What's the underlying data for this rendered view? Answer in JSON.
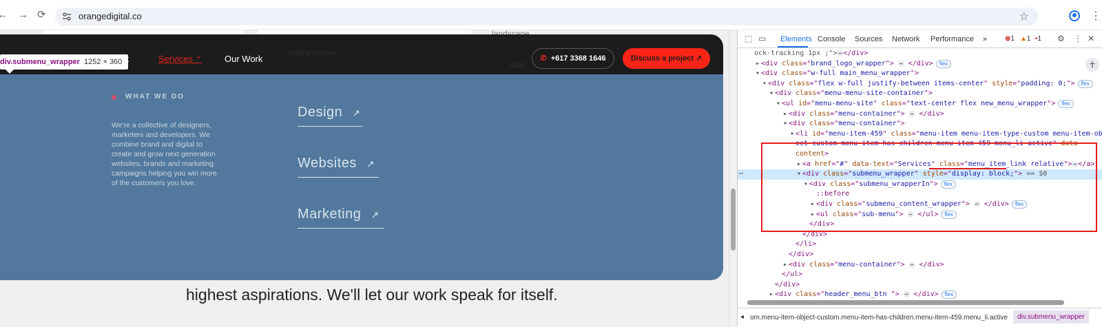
{
  "browser": {
    "back_icon": "arrow-left-icon",
    "forward_icon": "arrow-right-icon",
    "reload_icon": "reload-icon",
    "url": "orangedigital.co"
  },
  "page": {
    "landscape_text": "landscape.",
    "nav": {
      "about": "bout",
      "services": "Services",
      "our_work": "Our Work"
    },
    "phone": "+617 3368 1646",
    "cta": "Discuss a project",
    "faded_text_1": "Start a journey",
    "faded_text_2": "Start",
    "submenu": {
      "heading": "WHAT WE DO",
      "about": "We're a collective of designers, marketers and developers. We combine brand and digital to create and grow next generation websites, brands and marketing campaigns helping you win more of the customers you love.",
      "items": [
        {
          "label": "Design"
        },
        {
          "label": "Websites"
        },
        {
          "label": "Marketing"
        }
      ]
    },
    "bottom_text": "highest aspirations. We'll let our work speak for itself.",
    "tooltip": {
      "selector": "div.submenu_wrapper",
      "size": "1252 × 360"
    }
  },
  "devtools": {
    "tabs": [
      "Elements",
      "Console",
      "Sources",
      "Network",
      "Performance"
    ],
    "active_tab": "Elements",
    "errors": "1",
    "warnings": "1",
    "issues": "1",
    "tree": [
      {
        "indent": 0,
        "parts": [
          [
            "dim",
            "ock-tracking 1px ;\">"
          ],
          [
            "ell",
            "⋯"
          ],
          [
            "tag",
            "</div>"
          ]
        ]
      },
      {
        "indent": 1,
        "caret": "▸",
        "parts": [
          [
            "tag",
            "<div "
          ],
          [
            "attr",
            "class"
          ],
          [
            "tag",
            "=\""
          ],
          [
            "val",
            "brand_logo_wrapper"
          ],
          [
            "tag",
            "\"> "
          ],
          [
            "ell",
            "⋯"
          ],
          [
            "tag",
            " </div>"
          ],
          [
            "pill",
            "flex"
          ]
        ]
      },
      {
        "indent": 1,
        "caret": "▾",
        "parts": [
          [
            "tag",
            "<div "
          ],
          [
            "attr",
            "class"
          ],
          [
            "tag",
            "=\""
          ],
          [
            "val",
            "w-full main_menu_wrapper"
          ],
          [
            "tag",
            "\">"
          ]
        ]
      },
      {
        "indent": 2,
        "caret": "▾",
        "parts": [
          [
            "tag",
            "<div "
          ],
          [
            "attr",
            "class"
          ],
          [
            "tag",
            "=\""
          ],
          [
            "val",
            "flex w-full justify-between items-center"
          ],
          [
            "tag",
            "\" "
          ],
          [
            "attr",
            "style"
          ],
          [
            "tag",
            "=\""
          ],
          [
            "val",
            "padding: 0;"
          ],
          [
            "tag",
            "\">"
          ],
          [
            "pill",
            "flex"
          ]
        ]
      },
      {
        "indent": 3,
        "caret": "▾",
        "parts": [
          [
            "tag",
            "<div "
          ],
          [
            "attr",
            "class"
          ],
          [
            "tag",
            "=\""
          ],
          [
            "val",
            "menu-menu-site-container"
          ],
          [
            "tag",
            "\">"
          ]
        ]
      },
      {
        "indent": 4,
        "caret": "▾",
        "parts": [
          [
            "tag",
            "<ul "
          ],
          [
            "attr",
            "id"
          ],
          [
            "tag",
            "=\""
          ],
          [
            "val",
            "menu-menu-site"
          ],
          [
            "tag",
            "\" "
          ],
          [
            "attr",
            "class"
          ],
          [
            "tag",
            "=\""
          ],
          [
            "val",
            "text-center flex new_menu_wrapper"
          ],
          [
            "tag",
            "\">"
          ],
          [
            "pill",
            "flex"
          ]
        ]
      },
      {
        "indent": 5,
        "caret": "▸",
        "parts": [
          [
            "tag",
            "<div "
          ],
          [
            "attr",
            "class"
          ],
          [
            "tag",
            "=\""
          ],
          [
            "val",
            "menu-container"
          ],
          [
            "tag",
            "\"> "
          ],
          [
            "ell",
            "⋯"
          ],
          [
            "tag",
            " </div>"
          ]
        ]
      },
      {
        "indent": 5,
        "caret": "▾",
        "parts": [
          [
            "tag",
            "<div "
          ],
          [
            "attr",
            "class"
          ],
          [
            "tag",
            "=\""
          ],
          [
            "val",
            "menu-container"
          ],
          [
            "tag",
            "\">"
          ]
        ]
      },
      {
        "indent": 6,
        "caret": "▾",
        "parts": [
          [
            "tag",
            "<li "
          ],
          [
            "attr",
            "id"
          ],
          [
            "tag",
            "=\""
          ],
          [
            "val",
            "menu-item-459"
          ],
          [
            "tag",
            "\" "
          ],
          [
            "attr",
            "class"
          ],
          [
            "tag",
            "=\""
          ],
          [
            "val",
            "menu-item menu-item-type-custom menu-item-obj"
          ]
        ]
      },
      {
        "indent": 6,
        "parts": [
          [
            "val",
            "ect-custom menu-item-has-children menu-item-459 menu_li active"
          ],
          [
            "tag",
            "\" "
          ],
          [
            "attr",
            "data-"
          ]
        ]
      },
      {
        "indent": 6,
        "parts": [
          [
            "attr",
            "content"
          ],
          [
            "tag",
            ">"
          ]
        ]
      },
      {
        "indent": 7,
        "caret": "▸",
        "parts": [
          [
            "tag",
            "<a "
          ],
          [
            "attr",
            "href"
          ],
          [
            "tag",
            "=\""
          ],
          [
            "val",
            "#"
          ],
          [
            "tag",
            "\" "
          ],
          [
            "attr",
            "data-text"
          ],
          [
            "tag",
            "=\""
          ],
          [
            "val",
            "Services"
          ],
          [
            "tag",
            "\" "
          ],
          [
            "attr",
            "class"
          ],
          [
            "tag",
            "=\""
          ],
          [
            "val",
            "menu_item_link  relative"
          ],
          [
            "tag",
            "\">"
          ],
          [
            "ell",
            "⋯"
          ],
          [
            "tag",
            "</a>"
          ]
        ]
      },
      {
        "indent": 7,
        "caret": "▾",
        "selected": true,
        "parts": [
          [
            "tag",
            "<div "
          ],
          [
            "attr",
            "class"
          ],
          [
            "tag",
            "=\""
          ],
          [
            "val",
            "submenu_wrapper"
          ],
          [
            "tag",
            "\" "
          ],
          [
            "attr",
            "style"
          ],
          [
            "tag",
            "=\""
          ],
          [
            "val",
            "display: block;"
          ],
          [
            "tag",
            "\">"
          ],
          [
            "dim",
            " == $0"
          ]
        ]
      },
      {
        "indent": 8,
        "caret": "▾",
        "parts": [
          [
            "tag",
            "<div "
          ],
          [
            "attr",
            "class"
          ],
          [
            "tag",
            "=\""
          ],
          [
            "val",
            "submenu_wrapperIn"
          ],
          [
            "tag",
            "\">"
          ],
          [
            "pill",
            "flex"
          ]
        ]
      },
      {
        "indent": 9,
        "parts": [
          [
            "tag",
            "::before"
          ]
        ]
      },
      {
        "indent": 9,
        "caret": "▸",
        "parts": [
          [
            "tag",
            "<div "
          ],
          [
            "attr",
            "class"
          ],
          [
            "tag",
            "=\""
          ],
          [
            "val",
            "submenu_content_wrapper"
          ],
          [
            "tag",
            "\"> "
          ],
          [
            "ell",
            "⋯"
          ],
          [
            "tag",
            " </div>"
          ],
          [
            "pill",
            "flex"
          ]
        ]
      },
      {
        "indent": 9,
        "caret": "▸",
        "parts": [
          [
            "tag",
            "<ul "
          ],
          [
            "attr",
            "class"
          ],
          [
            "tag",
            "=\""
          ],
          [
            "val",
            "sub-menu"
          ],
          [
            "tag",
            "\"> "
          ],
          [
            "ell",
            "⋯"
          ],
          [
            "tag",
            " </ul>"
          ],
          [
            "pill",
            "flex"
          ]
        ]
      },
      {
        "indent": 8,
        "parts": [
          [
            "tag",
            "</div>"
          ]
        ]
      },
      {
        "indent": 7,
        "parts": [
          [
            "tag",
            "</div>"
          ]
        ]
      },
      {
        "indent": 6,
        "parts": [
          [
            "tag",
            "</li>"
          ]
        ]
      },
      {
        "indent": 5,
        "parts": [
          [
            "tag",
            "</div>"
          ]
        ]
      },
      {
        "indent": 5,
        "caret": "▸",
        "parts": [
          [
            "tag",
            "<div "
          ],
          [
            "attr",
            "class"
          ],
          [
            "tag",
            "=\""
          ],
          [
            "val",
            "menu-container"
          ],
          [
            "tag",
            "\"> "
          ],
          [
            "ell",
            "⋯"
          ],
          [
            "tag",
            " </div>"
          ]
        ]
      },
      {
        "indent": 4,
        "parts": [
          [
            "tag",
            "</ul>"
          ]
        ]
      },
      {
        "indent": 3,
        "parts": [
          [
            "tag",
            "</div>"
          ]
        ]
      },
      {
        "indent": 3,
        "caret": "▸",
        "parts": [
          [
            "tag",
            "<div "
          ],
          [
            "attr",
            "class"
          ],
          [
            "tag",
            "=\""
          ],
          [
            "val",
            "header_menu_btn "
          ],
          [
            "tag",
            "\"> "
          ],
          [
            "ell",
            "⋯"
          ],
          [
            "tag",
            " </div>"
          ],
          [
            "pill",
            "flex"
          ]
        ]
      },
      {
        "indent": 2,
        "parts": [
          [
            "tag",
            "</div>"
          ]
        ]
      }
    ],
    "breadcrumb_text": "om.menu-item-object-custom.menu-item-has-children.menu-item-459.menu_li.active",
    "breadcrumb_active": "div.submenu_wrapper"
  },
  "colors": {
    "accent_red": "#ff2418",
    "submenu_blue": "#4a7296",
    "devtools_blue": "#1a73e8",
    "highlight_box": "#e51b1b"
  }
}
